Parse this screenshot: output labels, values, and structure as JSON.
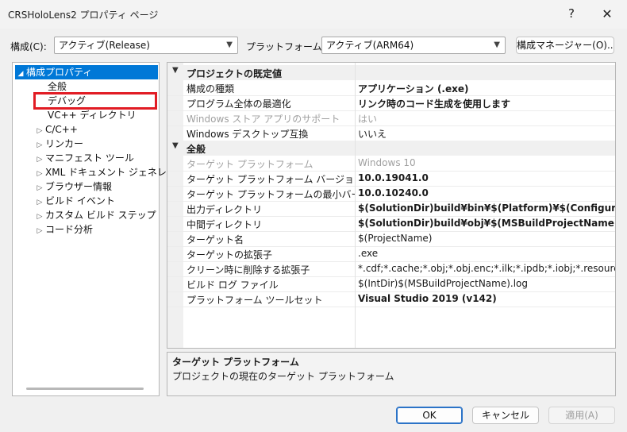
{
  "window": {
    "title": "CRSHoloLens2 プロパティ ページ",
    "help_glyph": "?",
    "close_glyph": "✕"
  },
  "toolbar": {
    "config_label": "構成(C):",
    "config_value": "アクティブ(Release)",
    "platform_label": "プラットフォーム(P):",
    "platform_value": "アクティブ(ARM64)",
    "manager_button": "構成マネージャー(O)..."
  },
  "tree": {
    "root": "構成プロパティ",
    "items": [
      {
        "label": "全般",
        "expandable": false
      },
      {
        "label": "デバッグ",
        "expandable": false
      },
      {
        "label": "VC++ ディレクトリ",
        "expandable": false
      },
      {
        "label": "C/C++",
        "expandable": true
      },
      {
        "label": "リンカー",
        "expandable": true
      },
      {
        "label": "マニフェスト ツール",
        "expandable": true
      },
      {
        "label": "XML ドキュメント ジェネレーター",
        "expandable": true
      },
      {
        "label": "ブラウザー情報",
        "expandable": true
      },
      {
        "label": "ビルド イベント",
        "expandable": true
      },
      {
        "label": "カスタム ビルド ステップ",
        "expandable": true
      },
      {
        "label": "コード分析",
        "expandable": true
      }
    ]
  },
  "grid": {
    "sections": [
      {
        "title": "プロジェクトの既定値",
        "rows": [
          {
            "name": "構成の種類",
            "value": "アプリケーション (.exe)",
            "bold": true,
            "dim": false
          },
          {
            "name": "プログラム全体の最適化",
            "value": "リンク時のコード生成を使用します",
            "bold": true,
            "dim": false
          },
          {
            "name": "Windows ストア アプリのサポート",
            "value": "はい",
            "bold": false,
            "dim": true
          },
          {
            "name": "Windows デスクトップ互換",
            "value": "いいえ",
            "bold": false,
            "dim": false
          }
        ]
      },
      {
        "title": "全般",
        "rows": [
          {
            "name": "ターゲット プラットフォーム",
            "value": "Windows 10",
            "bold": false,
            "dim": true
          },
          {
            "name": "ターゲット プラットフォーム バージョン",
            "value": "10.0.19041.0",
            "bold": true,
            "dim": false
          },
          {
            "name": "ターゲット プラットフォームの最小バージョン",
            "value": "10.0.10240.0",
            "bold": true,
            "dim": false
          },
          {
            "name": "出力ディレクトリ",
            "value": "$(SolutionDir)build¥bin¥$(Platform)¥$(Configuration)¥",
            "bold": true,
            "dim": false
          },
          {
            "name": "中間ディレクトリ",
            "value": "$(SolutionDir)build¥obj¥$(MSBuildProjectName)¥$(Platform",
            "bold": true,
            "dim": false
          },
          {
            "name": "ターゲット名",
            "value": "$(ProjectName)",
            "bold": false,
            "dim": false
          },
          {
            "name": "ターゲットの拡張子",
            "value": ".exe",
            "bold": false,
            "dim": false
          },
          {
            "name": "クリーン時に削除する拡張子",
            "value": "*.cdf;*.cache;*.obj;*.obj.enc;*.ilk;*.ipdb;*.iobj;*.resources;*.tlb;*",
            "bold": false,
            "dim": false
          },
          {
            "name": "ビルド ログ ファイル",
            "value": "$(IntDir)$(MSBuildProjectName).log",
            "bold": false,
            "dim": false
          },
          {
            "name": "プラットフォーム ツールセット",
            "value": "Visual Studio 2019 (v142)",
            "bold": true,
            "dim": false
          }
        ]
      }
    ]
  },
  "description": {
    "title": "ターゲット プラットフォーム",
    "body": "プロジェクトの現在のターゲット プラットフォーム"
  },
  "buttons": {
    "ok": "OK",
    "cancel": "キャンセル",
    "apply": "適用(A)"
  },
  "colors": {
    "selection": "#0078d7",
    "highlight_box": "#e11c24"
  }
}
